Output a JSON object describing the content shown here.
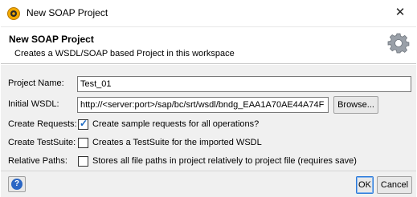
{
  "window": {
    "title": "New SOAP Project",
    "close_glyph": "✕",
    "icon": "soapui-logo-icon"
  },
  "header": {
    "title": "New SOAP Project",
    "description": "Creates a WSDL/SOAP based Project in this workspace",
    "icon": "gear-icon"
  },
  "form": {
    "project_name": {
      "label": "Project Name:",
      "value": "Test_01"
    },
    "initial_wsdl": {
      "label": "Initial WSDL:",
      "value": "http://<server:port>/sap/bc/srt/wsdl/bndg_EAA1A70AE44A74F",
      "browse_label": "Browse..."
    },
    "create_requests": {
      "label": "Create Requests:",
      "checked": true,
      "text": "Create sample requests for all operations?"
    },
    "create_testsuite": {
      "label": "Create TestSuite:",
      "checked": false,
      "text": "Creates a TestSuite for the imported WSDL"
    },
    "relative_paths": {
      "label": "Relative Paths:",
      "checked": false,
      "text": "Stores all file paths in project relatively to project file (requires save)"
    }
  },
  "footer": {
    "help_glyph": "?",
    "ok_label": "OK",
    "cancel_label": "Cancel"
  },
  "colors": {
    "accent": "#2b79d8",
    "panel_bg": "#f0f0f0"
  }
}
